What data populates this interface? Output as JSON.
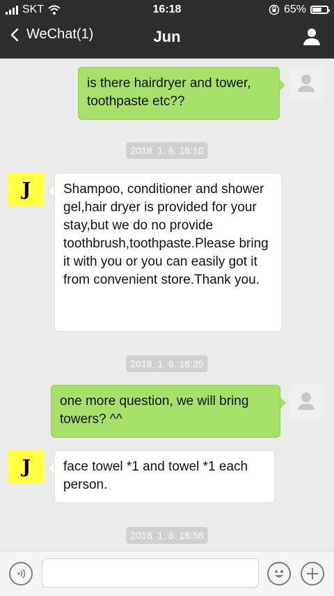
{
  "status": {
    "carrier": "SKT",
    "time": "16:18",
    "battery_percent": "65%",
    "battery_level": 0.65,
    "icons": [
      "signal-icon",
      "wifi-icon",
      "rotation-lock-icon",
      "battery-icon"
    ]
  },
  "nav": {
    "back_label": "WeChat(1)",
    "title": "Jun",
    "icons": [
      "chevron-left-icon",
      "person-icon"
    ]
  },
  "messages": {
    "m1": {
      "sender": "me",
      "text": "is there hairdryer and tower, toothpaste etc??"
    },
    "t1": "2018. 1. 6. 16:10",
    "m2": {
      "sender": "Jun",
      "avatar_letter": "J",
      "text": "Shampoo, conditioner and shower gel,hair dryer is provided for your stay,but we do no provide toothbrush,toothpaste.Please bring it with you or you can easily got it from convenient store.Thank you."
    },
    "t2": "2018. 1. 6. 16:25",
    "m3": {
      "sender": "me",
      "text": "one more question, we will bring towers? ^^"
    },
    "m4": {
      "sender": "Jun",
      "avatar_letter": "J",
      "text": "face towel *1 and towel *1 each person."
    },
    "t3": "2018. 1. 6. 16:58"
  },
  "input": {
    "value": "",
    "icons": [
      "voice-icon",
      "emoji-icon",
      "plus-icon"
    ]
  },
  "colors": {
    "header_bg": "#2e2e30",
    "chat_bg": "#ebebeb",
    "sent_bubble": "#a6e068",
    "received_bubble": "#ffffff",
    "avatar_j_bg": "#ffff44",
    "timestamp_bg": "#d1d1d1"
  }
}
